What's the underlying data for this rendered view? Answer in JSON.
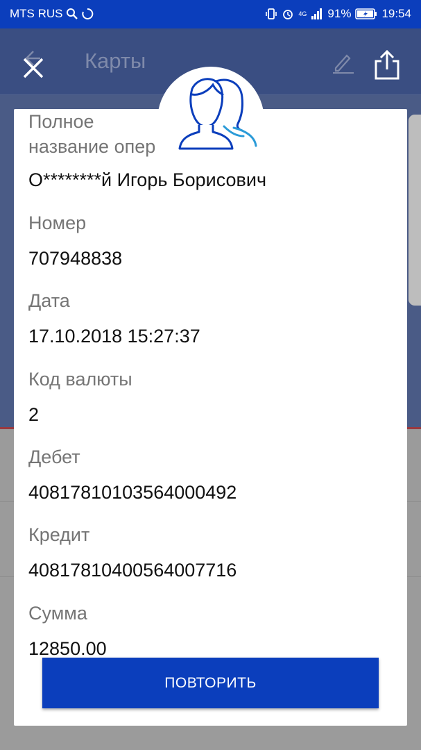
{
  "status_bar": {
    "carrier": "MTS RUS",
    "network_type": "4G",
    "battery": "91%",
    "time": "19:54",
    "icons": [
      "search-icon",
      "sync-icon",
      "vibrate-icon",
      "alarm-icon",
      "signal-icon",
      "battery-icon"
    ]
  },
  "app_bar": {
    "title": "Карты",
    "icons": [
      "back-arrow-icon",
      "pencil-icon",
      "share-icon"
    ]
  },
  "dialog": {
    "avatar_icon": "users-icon",
    "fields": [
      {
        "label": "Полное название опер",
        "value": "О********й Игорь Борисович"
      },
      {
        "label": "Номер",
        "value": "707948838"
      },
      {
        "label": "Дата",
        "value": "17.10.2018 15:27:37"
      },
      {
        "label": "Код валюты",
        "value": "2"
      },
      {
        "label": "Дебет",
        "value": "40817810103564000492"
      },
      {
        "label": "Кредит",
        "value": "40817810400564007716"
      },
      {
        "label": "Сумма",
        "value": "12850.00"
      }
    ],
    "repeat_button": "ПОВТОРИТЬ"
  },
  "colors": {
    "primary": "#0b3ebc",
    "label_gray": "#757575",
    "avatar_stroke": "#0b3ebc",
    "avatar_accent": "#2b9bd8"
  }
}
